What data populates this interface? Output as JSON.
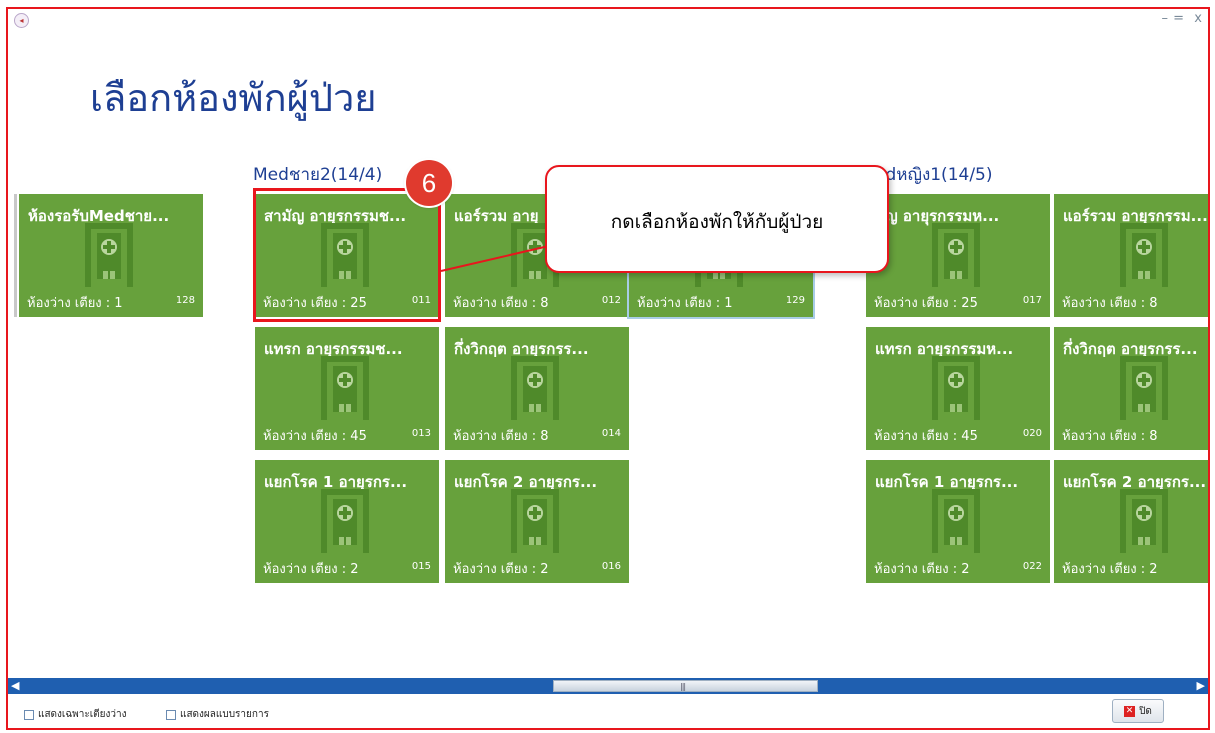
{
  "window": {
    "minimize": "–",
    "maximize": "=",
    "close": "x"
  },
  "page_title": "เลือกห้องพักผู้ป่วย",
  "groups": [
    {
      "title": "Medชาย2(14/4)"
    },
    {
      "title": "edหญิง1(14/5)"
    }
  ],
  "tiles": [
    {
      "name": "ห้องรอรับMedชาย...",
      "avail": "ห้องว่าง เตียง : 1",
      "code": "128"
    },
    {
      "name": "สามัญ อายุรกรรมช...",
      "avail": "ห้องว่าง เตียง : 25",
      "code": "011"
    },
    {
      "name": "แอร์รวม อายุ",
      "avail": "ห้องว่าง เตียง : 8",
      "code": "012"
    },
    {
      "name": "",
      "avail": "ห้องว่าง เตียง : 1",
      "code": "129"
    },
    {
      "name": "มัญ อายุรกรรมห...",
      "avail": "ห้องว่าง เตียง : 25",
      "code": "017"
    },
    {
      "name": "แอร์รวม อายุรกรรม...",
      "avail": "ห้องว่าง เตียง : 8",
      "code": "01"
    },
    {
      "name": "แทรก อายุรกรรมช...",
      "avail": "ห้องว่าง เตียง : 45",
      "code": "013"
    },
    {
      "name": "กึ่งวิกฤต อายุรกรร...",
      "avail": "ห้องว่าง เตียง : 8",
      "code": "014"
    },
    {
      "name": "แทรก อายุรกรรมห...",
      "avail": "ห้องว่าง เตียง : 45",
      "code": "020"
    },
    {
      "name": "กึ่งวิกฤต อายุรกรร...",
      "avail": "ห้องว่าง เตียง : 8",
      "code": "02"
    },
    {
      "name": "แยกโรค 1 อายุรกร...",
      "avail": "ห้องว่าง เตียง : 2",
      "code": "015"
    },
    {
      "name": "แยกโรค 2 อายุรกร...",
      "avail": "ห้องว่าง เตียง : 2",
      "code": "016"
    },
    {
      "name": "แยกโรค 1 อายุรกร...",
      "avail": "ห้องว่าง เตียง : 2",
      "code": "022"
    },
    {
      "name": "แยกโรค 2 อายุรกร...",
      "avail": "ห้องว่าง เตียง : 2",
      "code": "02"
    }
  ],
  "annotation": {
    "step": "6",
    "callout": "กดเลือกห้องพักให้กับผู้ป่วย"
  },
  "footer": {
    "show_empty_only": "แสดงเฉพาะเตียงว่าง",
    "show_as_list": "แสดงผลแบบรายการ",
    "close_button": "ปิด"
  },
  "colors": {
    "tile": "#67a13c",
    "heading": "#1e3f93",
    "annotation_red": "#e8161d",
    "scrollbar": "#1f5fb0"
  }
}
